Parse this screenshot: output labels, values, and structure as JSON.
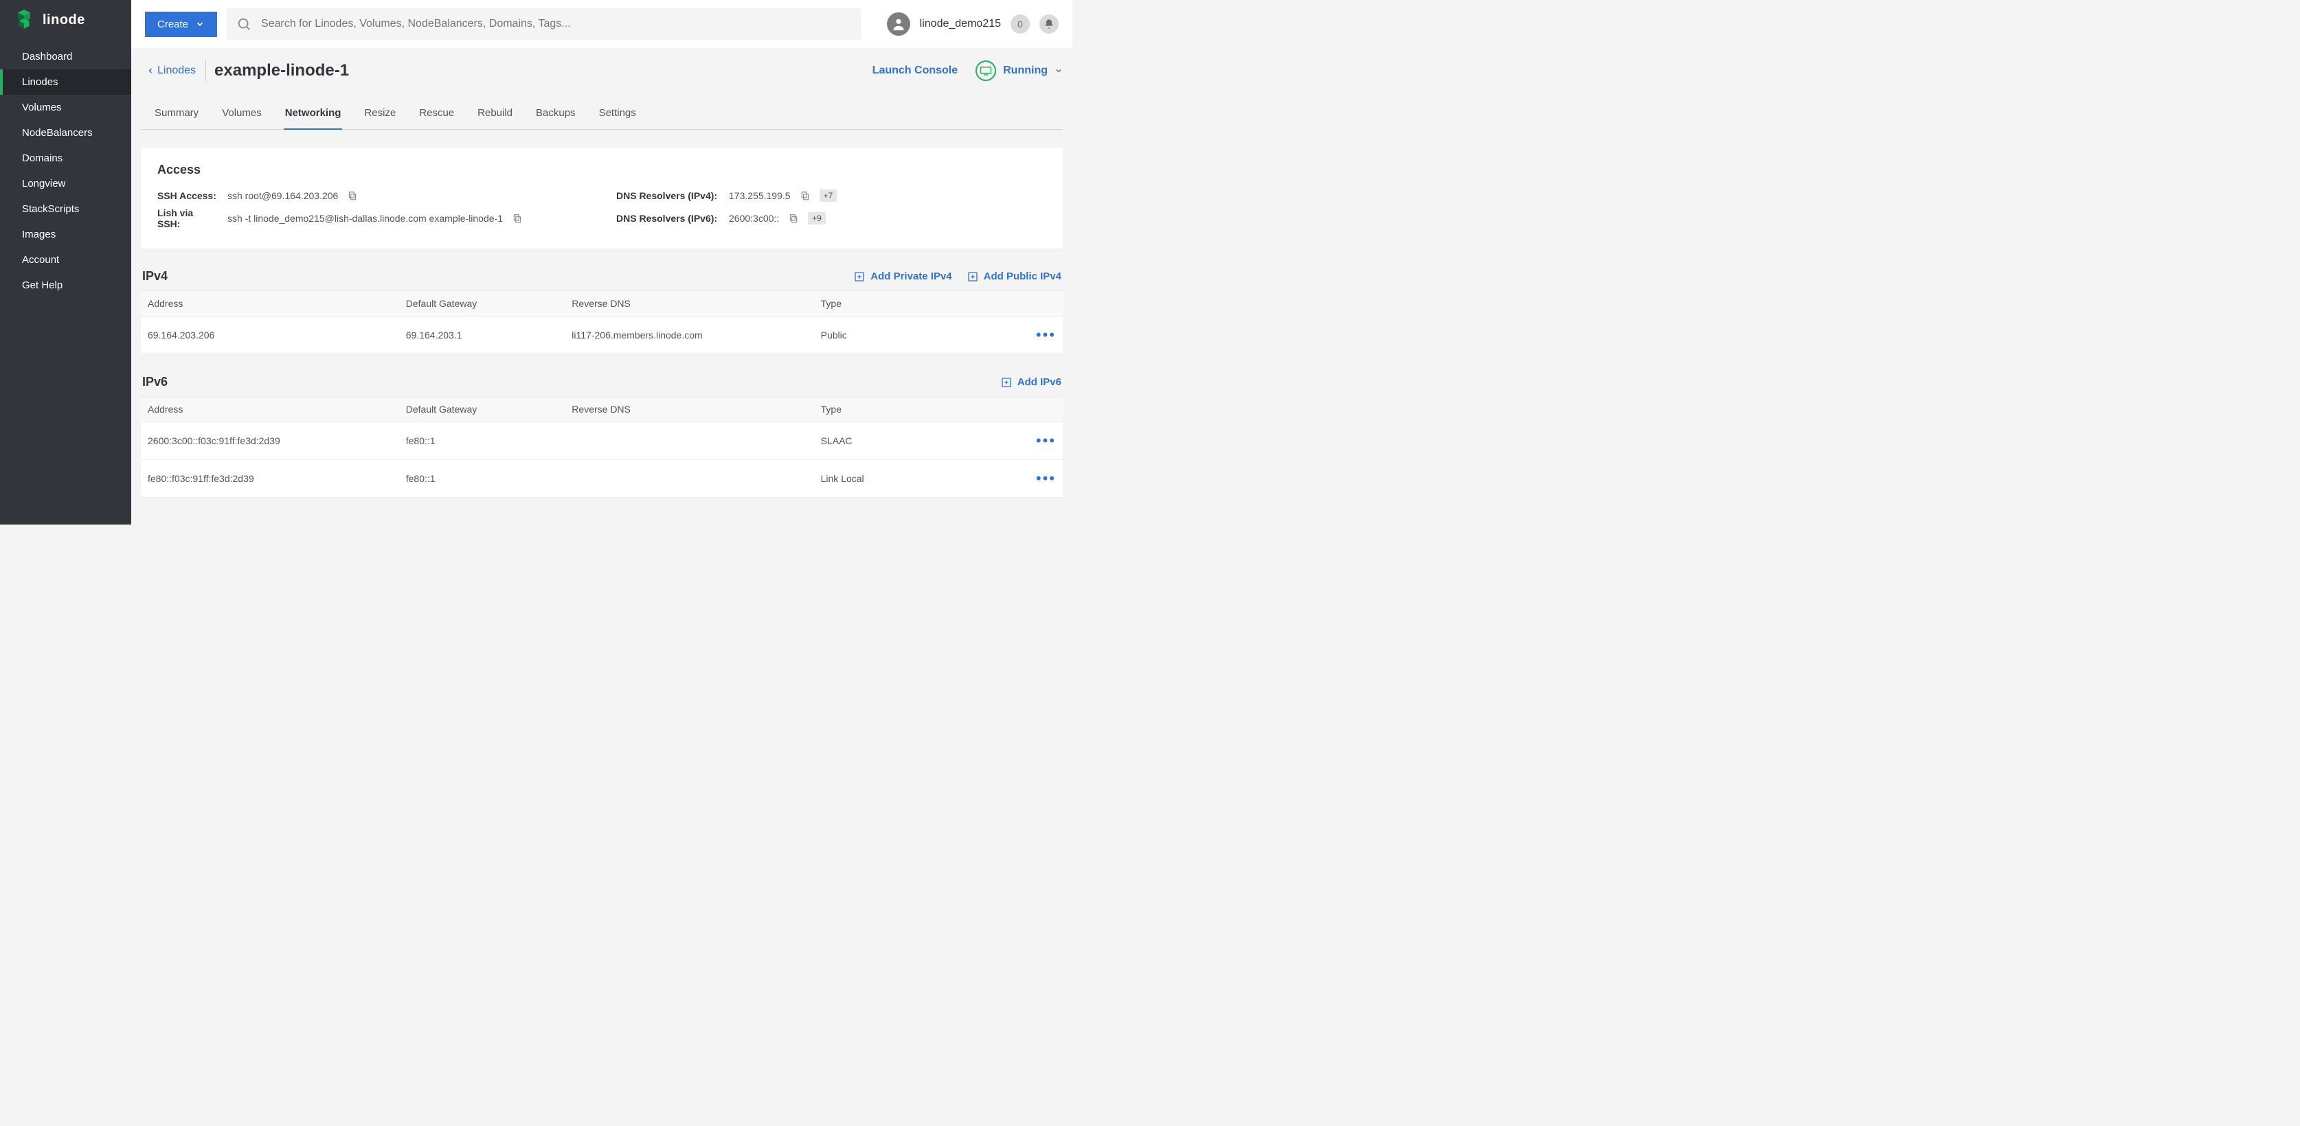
{
  "brand": {
    "name": "linode"
  },
  "sidebar": {
    "items": [
      {
        "label": "Dashboard"
      },
      {
        "label": "Linodes"
      },
      {
        "label": "Volumes"
      },
      {
        "label": "NodeBalancers"
      },
      {
        "label": "Domains"
      },
      {
        "label": "Longview"
      },
      {
        "label": "StackScripts"
      },
      {
        "label": "Images"
      },
      {
        "label": "Account"
      },
      {
        "label": "Get Help"
      }
    ],
    "active_index": 1
  },
  "topbar": {
    "create_label": "Create",
    "search_placeholder": "Search for Linodes, Volumes, NodeBalancers, Domains, Tags...",
    "username": "linode_demo215",
    "notification_count": "0"
  },
  "header": {
    "back_label": "Linodes",
    "title": "example-linode-1",
    "launch_label": "Launch Console",
    "status_label": "Running"
  },
  "tabs": {
    "items": [
      {
        "label": "Summary"
      },
      {
        "label": "Volumes"
      },
      {
        "label": "Networking"
      },
      {
        "label": "Resize"
      },
      {
        "label": "Rescue"
      },
      {
        "label": "Rebuild"
      },
      {
        "label": "Backups"
      },
      {
        "label": "Settings"
      }
    ],
    "active_index": 2
  },
  "access": {
    "heading": "Access",
    "ssh_label": "SSH Access:",
    "ssh_value": "ssh root@69.164.203.206",
    "lish_label": "Lish via SSH:",
    "lish_value": "ssh -t linode_demo215@lish-dallas.linode.com example-linode-1",
    "dns4_label": "DNS Resolvers (IPv4):",
    "dns4_value": "173.255.199.5",
    "dns4_extra": "+7",
    "dns6_label": "DNS Resolvers (IPv6):",
    "dns6_value": "2600:3c00::",
    "dns6_extra": "+9"
  },
  "ipv4": {
    "heading": "IPv4",
    "add_private_label": "Add Private IPv4",
    "add_public_label": "Add Public IPv4",
    "columns": {
      "address": "Address",
      "gateway": "Default Gateway",
      "rdns": "Reverse DNS",
      "type": "Type"
    },
    "rows": [
      {
        "address": "69.164.203.206",
        "gateway": "69.164.203.1",
        "rdns": "li117-206.members.linode.com",
        "type": "Public"
      }
    ]
  },
  "ipv6": {
    "heading": "IPv6",
    "add_label": "Add IPv6",
    "columns": {
      "address": "Address",
      "gateway": "Default Gateway",
      "rdns": "Reverse DNS",
      "type": "Type"
    },
    "rows": [
      {
        "address": "2600:3c00::f03c:91ff:fe3d:2d39",
        "gateway": "fe80::1",
        "rdns": "",
        "type": "SLAAC"
      },
      {
        "address": "fe80::f03c:91ff:fe3d:2d39",
        "gateway": "fe80::1",
        "rdns": "",
        "type": "Link Local"
      }
    ]
  }
}
